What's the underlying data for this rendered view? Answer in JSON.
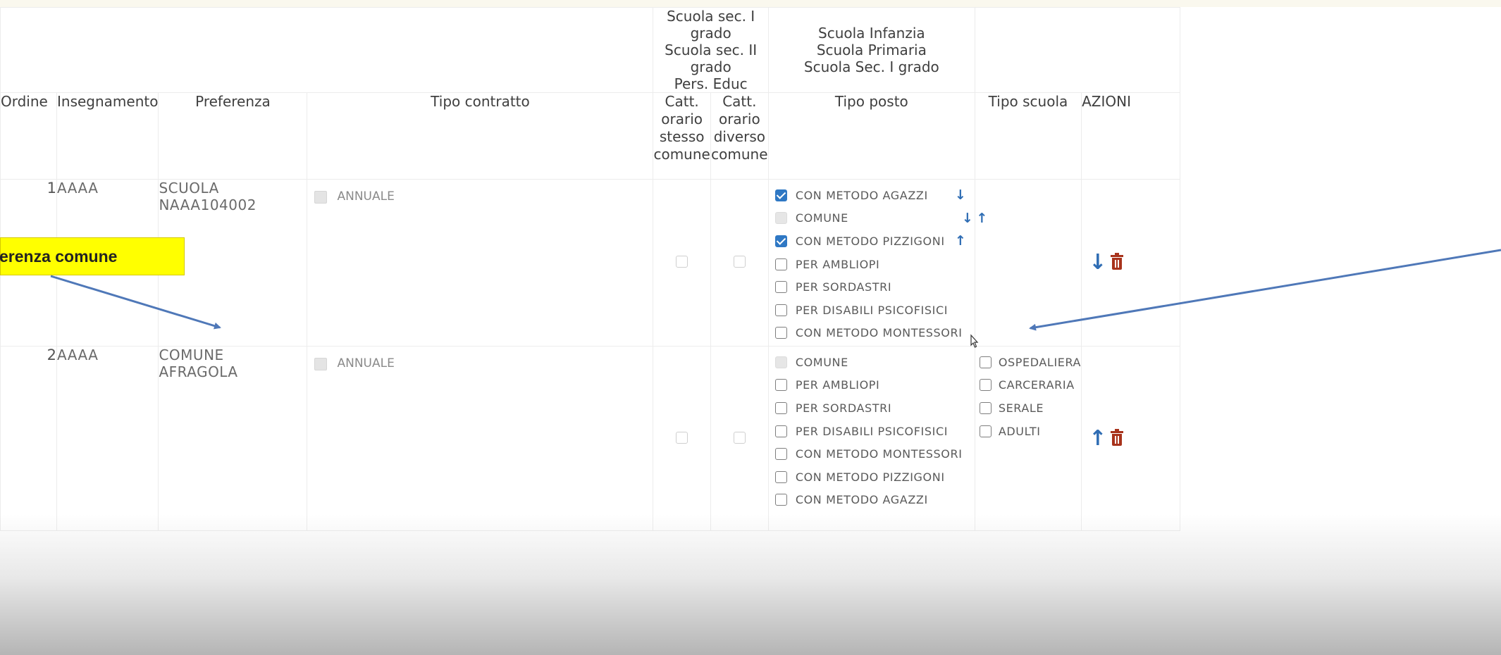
{
  "group_headers": {
    "col_catt": [
      "Scuola sec. I grado",
      "Scuola sec. II grado",
      "Pers. Educ"
    ],
    "col_tipo_posto": [
      "Scuola Infanzia",
      "Scuola Primaria",
      "Scuola Sec. I grado"
    ]
  },
  "headers": {
    "ordine": "Ordine",
    "insegnamento": "Insegnamento",
    "preferenza": "Preferenza",
    "tipo_contratto": "Tipo contratto",
    "catt_stesso": [
      "Catt.",
      "orario",
      "stesso",
      "comune"
    ],
    "catt_diverso": [
      "Catt.",
      "orario",
      "diverso",
      "comune"
    ],
    "tipo_posto": "Tipo posto",
    "tipo_scuola": "Tipo scuola",
    "azioni": "AZIONI"
  },
  "rows": [
    {
      "ordine": "1",
      "insegnamento": "AAAA",
      "preferenza": "SCUOLA NAAA104002",
      "contratto": "ANNUALE",
      "tipo_posto": [
        {
          "label": "CON METODO AGAZZI",
          "state": "checked",
          "arrows": "down"
        },
        {
          "label": "COMUNE",
          "state": "disabled",
          "arrows": "down-up"
        },
        {
          "label": "CON METODO PIZZIGONI",
          "state": "checked",
          "arrows": "up"
        },
        {
          "label": "PER AMBLIOPI",
          "state": "unchecked",
          "arrows": ""
        },
        {
          "label": "PER SORDASTRI",
          "state": "unchecked",
          "arrows": ""
        },
        {
          "label": "PER DISABILI PSICOFISICI",
          "state": "unchecked",
          "arrows": ""
        },
        {
          "label": "CON METODO MONTESSORI",
          "state": "unchecked",
          "arrows": ""
        }
      ],
      "tipo_scuola": [],
      "action_arrow": "↓"
    },
    {
      "ordine": "2",
      "insegnamento": "AAAA",
      "preferenza": "COMUNE AFRAGOLA",
      "contratto": "ANNUALE",
      "tipo_posto": [
        {
          "label": "COMUNE",
          "state": "disabled",
          "arrows": ""
        },
        {
          "label": "PER AMBLIOPI",
          "state": "unchecked",
          "arrows": ""
        },
        {
          "label": "PER SORDASTRI",
          "state": "unchecked",
          "arrows": ""
        },
        {
          "label": "PER DISABILI PSICOFISICI",
          "state": "unchecked",
          "arrows": ""
        },
        {
          "label": "CON METODO MONTESSORI",
          "state": "unchecked",
          "arrows": ""
        },
        {
          "label": "CON METODO PIZZIGONI",
          "state": "unchecked",
          "arrows": ""
        },
        {
          "label": "CON METODO AGAZZI",
          "state": "unchecked",
          "arrows": ""
        }
      ],
      "tipo_scuola": [
        "OSPEDALIERA",
        "CARCERARIA",
        "SERALE",
        "ADULTI"
      ],
      "action_arrow": "↑"
    }
  ],
  "annotation": {
    "callout_text": "erenza comune",
    "callout_color": "#ffff00",
    "arrow_color": "#4f78b8"
  },
  "colors": {
    "checkbox_checked": "#2f78c4",
    "trash_icon": "#a8331c",
    "arrow_icon": "#2f6db4"
  }
}
